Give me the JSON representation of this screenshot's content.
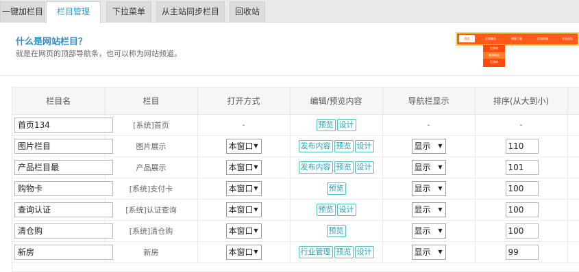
{
  "tabs": [
    {
      "label": "一键加栏目",
      "active": false
    },
    {
      "label": "栏目管理",
      "active": true
    },
    {
      "label": "下拉菜单",
      "active": false
    },
    {
      "label": "从主站同步栏目",
      "active": false
    },
    {
      "label": "回收站",
      "active": false
    }
  ],
  "info": {
    "title": "什么是网站栏目？",
    "description": "就是在网页的顶部导航条，也可以称为网站频道。"
  },
  "table": {
    "headers": [
      "栏目名",
      "栏目",
      "打开方式",
      "编辑/预览内容",
      "导航栏显示",
      "排序(从大到小)"
    ],
    "rows": [
      {
        "name": "首页134",
        "column": "[系统]首页",
        "open": "-",
        "actions": [
          "预览",
          "设计"
        ],
        "nav": "-",
        "order": "-"
      },
      {
        "name": "图片栏目",
        "column": "图片展示",
        "open": "本窗口",
        "actions": [
          "发布内容",
          "预览",
          "设计"
        ],
        "nav": "显示",
        "order": "110"
      },
      {
        "name": "产品栏目最",
        "column": "产品展示",
        "open": "本窗口",
        "actions": [
          "发布内容",
          "预览",
          "设计"
        ],
        "nav": "显示",
        "order": "101"
      },
      {
        "name": "购物卡",
        "column": "[系统]支付卡",
        "open": "本窗口",
        "actions": [
          "预览"
        ],
        "nav": "显示",
        "order": "100"
      },
      {
        "name": "查询认证",
        "column": "[系统]认证查询",
        "open": "本窗口",
        "actions": [
          "预览",
          "设计"
        ],
        "nav": "显示",
        "order": "100"
      },
      {
        "name": "清仓购",
        "column": "[系统]清仓购",
        "open": "本窗口",
        "actions": [
          "预览"
        ],
        "nav": "显示",
        "order": "100"
      },
      {
        "name": "新房",
        "column": "新房",
        "open": "本窗口",
        "actions": [
          "行业管理",
          "预览",
          "设计"
        ],
        "nav": "显示",
        "order": "99"
      }
    ]
  },
  "preview": {
    "nav_items": [
      "首页",
      "后润服务",
      "博客力量",
      "后润商城",
      "学员论坛"
    ],
    "dropdown_items": [
      "后润商",
      "普通商品",
      "后润商"
    ]
  },
  "colors": {
    "accent": "#2a9fd6",
    "button_border": "#4ec0c0",
    "preview_orange": "#ff5a1a"
  },
  "icons": {
    "select_arrow": "▼"
  }
}
